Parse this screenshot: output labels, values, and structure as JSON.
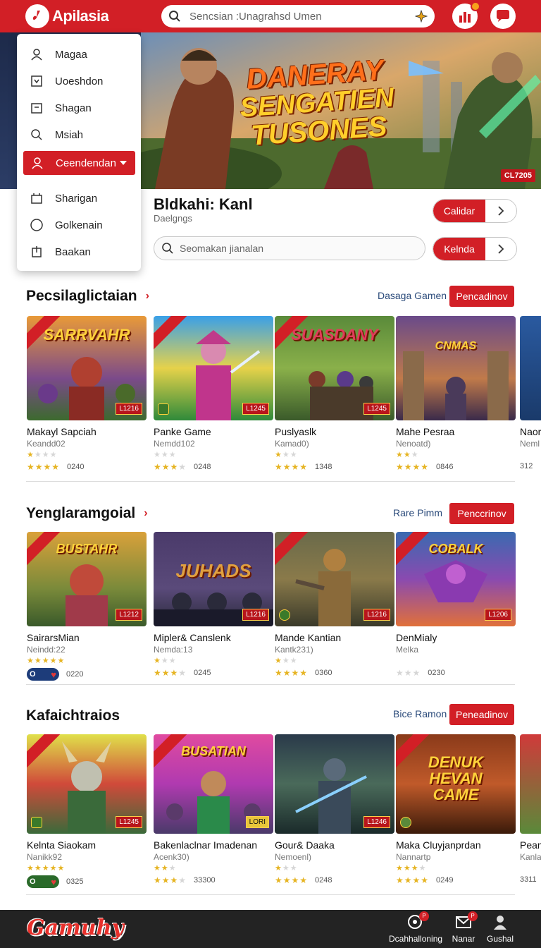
{
  "app": {
    "name": "Apilasia"
  },
  "search": {
    "placeholder": "Sencsian :Unagrahsd Umen"
  },
  "menu": {
    "items": [
      {
        "label": "Magaa",
        "icon": "user-icon"
      },
      {
        "label": "Uoeshdon",
        "icon": "download-box-icon"
      },
      {
        "label": "Shagan",
        "icon": "folder-icon"
      },
      {
        "label": "Msiah",
        "icon": "search-icon"
      },
      {
        "label": "Ceendendan",
        "icon": "user-icon",
        "active": true
      },
      {
        "label": "Sharigan",
        "icon": "cart-icon"
      },
      {
        "label": "Golkenain",
        "icon": "circle-icon"
      },
      {
        "label": "Baakan",
        "icon": "download-arrow-icon"
      }
    ]
  },
  "hero": {
    "title_lines": [
      "DANERAY",
      "SENGATIEN",
      "TUSONES"
    ],
    "badge": "CL7205"
  },
  "profile": {
    "name": "Bldkahi: Kanl",
    "subtitle": "Daelgngs",
    "button1": "Calidar",
    "button2": "Kelnda",
    "search_placeholder": "Seomakan jianalan"
  },
  "sections": [
    {
      "title": "Pecsilaglictaian",
      "link": "Dasaga Gamen",
      "button": "Pencadinov",
      "games": [
        {
          "thumb_title": "SARRVAHR",
          "price": "L1216",
          "name": "Makayl Sapciah",
          "dev": "Keandd02",
          "rating": "0240"
        },
        {
          "thumb_title": "",
          "price": "L1245",
          "name": "Panke Game",
          "dev": "Nemdd102",
          "rating": "0248"
        },
        {
          "thumb_title": "SUASDANY",
          "price": "L1245",
          "name": "Puslyaslk",
          "dev": "Kamad0)",
          "rating": "1348"
        },
        {
          "thumb_title": "CNMAS",
          "price": "",
          "name": "Mahe Pesraa",
          "dev": "Nenoatd)",
          "rating": "0846"
        },
        {
          "thumb_title": "",
          "price": "",
          "name": "Naor",
          "dev": "Neml",
          "rating": "312"
        }
      ]
    },
    {
      "title": "Yenglaramgoial",
      "link": "Rare Pimm",
      "button": "Penccrinov",
      "games": [
        {
          "thumb_title": "BUSTAHR",
          "price": "L1212",
          "name": "SairarsMian",
          "dev": "Neindd:22",
          "rating": "0220"
        },
        {
          "thumb_title": "JUHADS",
          "price": "L1216",
          "name": "Mipler& Canslenk",
          "dev": "Nemda:13",
          "rating": "0245"
        },
        {
          "thumb_title": "",
          "price": "L1216",
          "name": "Mande Kantian",
          "dev": "Kantk231)",
          "rating": "0360"
        },
        {
          "thumb_title": "COBALK",
          "price": "L1206",
          "name": "DenMialy",
          "dev": "Melka",
          "rating": "0230"
        }
      ]
    },
    {
      "title": "Kafaichtraios",
      "link": "Bice Ramon",
      "button": "Peneadinov",
      "games": [
        {
          "thumb_title": "",
          "price": "L1245",
          "name": "Kelnta Siaokam",
          "dev": "Nanikk92",
          "rating": "0325"
        },
        {
          "thumb_title": "BUSATIAN",
          "price": "LORI",
          "name": "Bakenlaclnar Imadenan",
          "dev": "Acenk30)",
          "rating": "33300"
        },
        {
          "thumb_title": "",
          "price": "L1246",
          "name": "Gour& Daaka",
          "dev": "Nemoenl)",
          "rating": "0248"
        },
        {
          "thumb_title": "DENUK HEVAN CAME",
          "price": "",
          "name": "Maka Cluyjanprdan",
          "dev": "Nannartp",
          "rating": "0249"
        },
        {
          "thumb_title": "",
          "price": "",
          "name": "Pean",
          "dev": "Kanla",
          "rating": "3311"
        }
      ]
    }
  ],
  "footer": {
    "logo": "Gamuhy",
    "items": [
      {
        "label": "Dcahhalloning"
      },
      {
        "label": "Nanar"
      },
      {
        "label": "Gushal"
      }
    ]
  }
}
